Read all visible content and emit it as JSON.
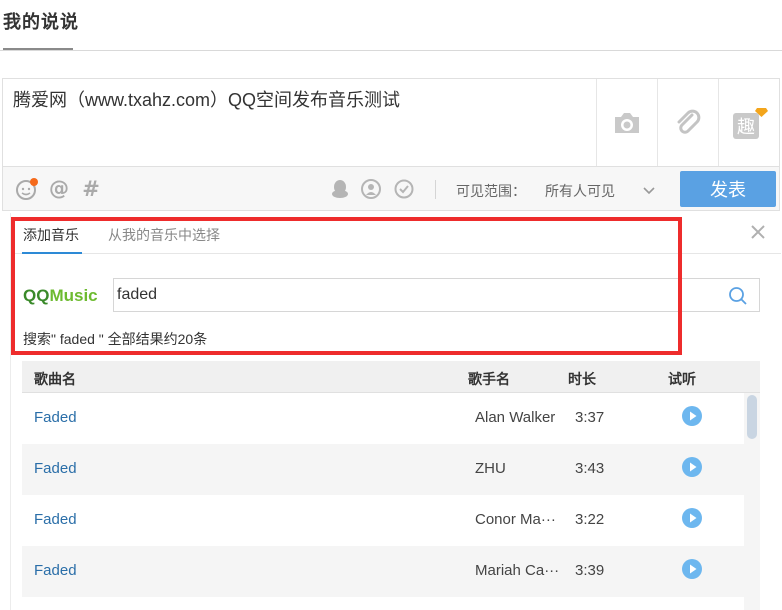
{
  "page": {
    "title": "我的说说"
  },
  "composer": {
    "text": "腾爱网（www.txahz.com）QQ空间发布音乐测试",
    "buttons": [
      "camera-icon",
      "attachment-icon",
      "fun-icon"
    ]
  },
  "toolbar": {
    "icons": [
      "emoji-icon",
      "mention-icon",
      "hashtag-icon",
      "qq-icon",
      "friend-icon",
      "clock-icon"
    ],
    "visibility_label": "可见范围：",
    "visibility_value": "所有人可见",
    "post_label": "发表"
  },
  "music_panel": {
    "tabs": [
      "添加音乐",
      "从我的音乐中选择"
    ],
    "logo": {
      "qq": "QQ",
      "music": "Music"
    },
    "search": {
      "value": "faded",
      "placeholder": ""
    },
    "result_text": "搜索\" faded \" 全部结果约20条",
    "columns": [
      "歌曲名",
      "歌手名",
      "时长",
      "试听"
    ],
    "songs": [
      {
        "title": "Faded",
        "artist": "Alan Walker",
        "duration": "3:37"
      },
      {
        "title": "Faded",
        "artist": "ZHU",
        "duration": "3:43"
      },
      {
        "title": "Faded",
        "artist": "Conor Ma···",
        "duration": "3:22"
      },
      {
        "title": "Faded",
        "artist": "Mariah Ca···",
        "duration": "3:39"
      }
    ]
  },
  "colors": {
    "accent": "#5aa1e3",
    "link": "#2a6ea8",
    "highlight": "#ee2c2c",
    "qq_green": "#3a8a2a"
  }
}
